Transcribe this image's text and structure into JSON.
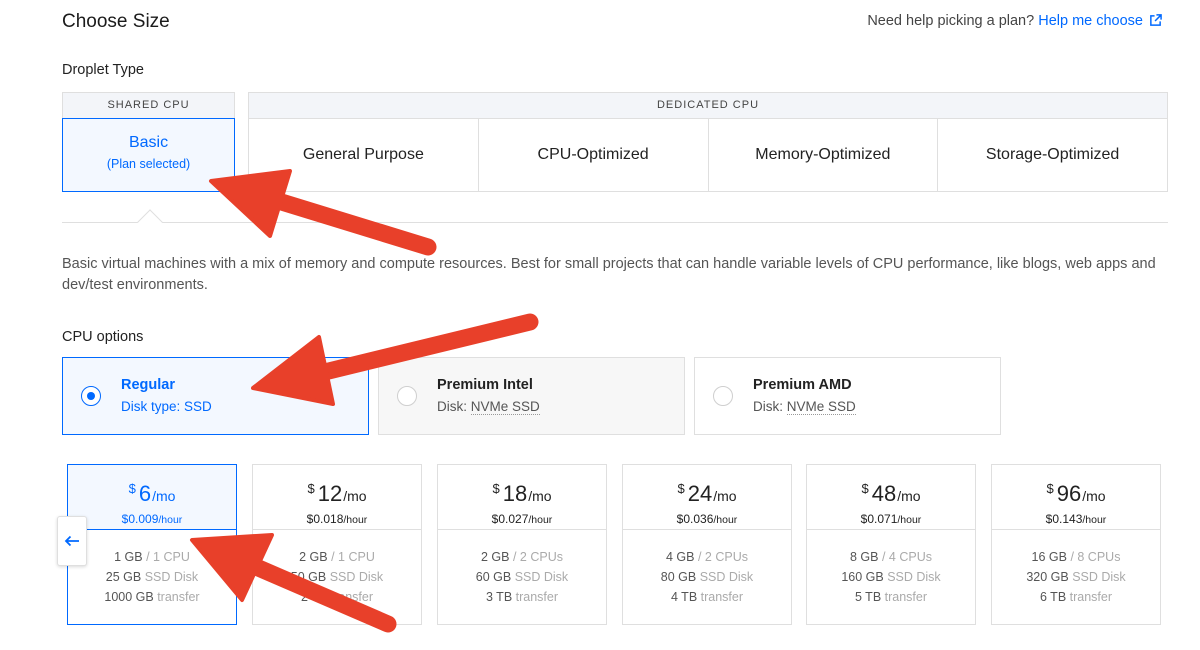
{
  "page_title": "Choose Size",
  "help": {
    "prefix": "Need help picking a plan?",
    "link": "Help me choose"
  },
  "droplet_type": {
    "label": "Droplet Type",
    "shared_header": "SHARED CPU",
    "basic": {
      "title": "Basic",
      "subtitle": "(Plan selected)"
    },
    "dedicated_header": "DEDICATED CPU",
    "dedicated": [
      "General Purpose",
      "CPU-Optimized",
      "Memory-Optimized",
      "Storage-Optimized"
    ]
  },
  "description": "Basic virtual machines with a mix of memory and compute resources. Best for small projects that can handle variable levels of CPU performance, like blogs, web apps and dev/test environments.",
  "cpu_options": {
    "label": "CPU options",
    "items": [
      {
        "name": "Regular",
        "disk_prefix": "Disk type: ",
        "disk_value": "SSD"
      },
      {
        "name": "Premium Intel",
        "disk_prefix": "Disk: ",
        "disk_value": "NVMe SSD"
      },
      {
        "name": "Premium AMD",
        "disk_prefix": "Disk: ",
        "disk_value": "NVMe SSD"
      }
    ]
  },
  "plans": [
    {
      "currency": "$",
      "price": "6",
      "per": "/mo",
      "hourly": "$0.009",
      "hour_unit": "/hour",
      "mem": "1 GB",
      "cpu": " / 1 CPU",
      "disk": "25 GB",
      "disk_label": " SSD Disk",
      "transfer": "1000 GB",
      "transfer_label": " transfer"
    },
    {
      "currency": "$",
      "price": "12",
      "per": "/mo",
      "hourly": "$0.018",
      "hour_unit": "/hour",
      "mem": "2 GB",
      "cpu": " / 1 CPU",
      "disk": "50 GB",
      "disk_label": " SSD Disk",
      "transfer": "2 TB",
      "transfer_label": " transfer"
    },
    {
      "currency": "$",
      "price": "18",
      "per": "/mo",
      "hourly": "$0.027",
      "hour_unit": "/hour",
      "mem": "2 GB",
      "cpu": " / 2 CPUs",
      "disk": "60 GB",
      "disk_label": " SSD Disk",
      "transfer": "3 TB",
      "transfer_label": " transfer"
    },
    {
      "currency": "$",
      "price": "24",
      "per": "/mo",
      "hourly": "$0.036",
      "hour_unit": "/hour",
      "mem": "4 GB",
      "cpu": " / 2 CPUs",
      "disk": "80 GB",
      "disk_label": " SSD Disk",
      "transfer": "4 TB",
      "transfer_label": " transfer"
    },
    {
      "currency": "$",
      "price": "48",
      "per": "/mo",
      "hourly": "$0.071",
      "hour_unit": "/hour",
      "mem": "8 GB",
      "cpu": " / 4 CPUs",
      "disk": "160 GB",
      "disk_label": " SSD Disk",
      "transfer": "5 TB",
      "transfer_label": " transfer"
    },
    {
      "currency": "$",
      "price": "96",
      "per": "/mo",
      "hourly": "$0.143",
      "hour_unit": "/hour",
      "mem": "16 GB",
      "cpu": " / 8 CPUs",
      "disk": "320 GB",
      "disk_label": " SSD Disk",
      "transfer": "6 TB",
      "transfer_label": " transfer"
    }
  ],
  "colors": {
    "accent": "#0069ff",
    "annotation_arrow": "#e8402a",
    "border": "#dfdfdf"
  },
  "icons": {
    "help_link": "external-link-icon",
    "scroll_back": "arrow-left-icon",
    "radio": "radio-icon"
  }
}
